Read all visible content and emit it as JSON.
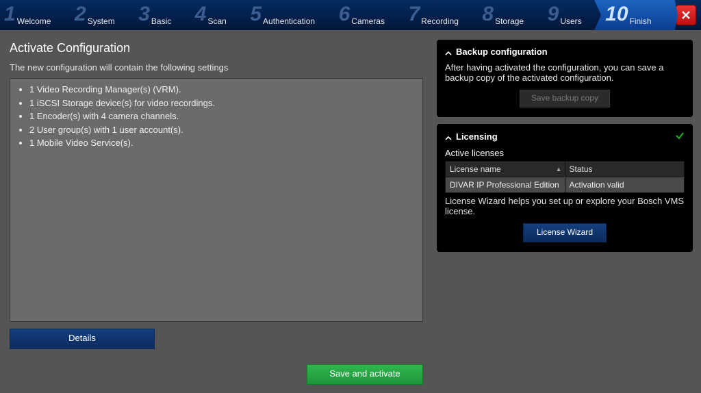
{
  "wizard": {
    "steps": [
      {
        "num": "1",
        "label": "Welcome"
      },
      {
        "num": "2",
        "label": "System"
      },
      {
        "num": "3",
        "label": "Basic"
      },
      {
        "num": "4",
        "label": "Scan"
      },
      {
        "num": "5",
        "label": "Authentication"
      },
      {
        "num": "6",
        "label": "Cameras"
      },
      {
        "num": "7",
        "label": "Recording"
      },
      {
        "num": "8",
        "label": "Storage"
      },
      {
        "num": "9",
        "label": "Users"
      },
      {
        "num": "10",
        "label": "Finish"
      }
    ],
    "active_index": 9
  },
  "page": {
    "title": "Activate Configuration",
    "subtitle": "The new configuration will contain the following settings",
    "config_items": [
      "1 Video Recording Manager(s) (VRM).",
      "1 iSCSI Storage device(s) for video recordings.",
      "1 Encoder(s) with 4 camera channels.",
      "2 User group(s) with 1 user account(s).",
      "1 Mobile Video Service(s)."
    ],
    "details_btn": "Details",
    "save_activate_btn": "Save and activate"
  },
  "backup": {
    "title": "Backup configuration",
    "text": "After having activated the configuration, you can save a backup copy of the activated configuration.",
    "button": "Save backup copy"
  },
  "licensing": {
    "title": "Licensing",
    "active_label": "Active licenses",
    "col_name": "License name",
    "col_status": "Status",
    "rows": [
      {
        "name": "DIVAR IP Professional Edition",
        "status": "Activation valid"
      }
    ],
    "help_text": "License Wizard helps you set up or explore your Bosch VMS license.",
    "wizard_btn": "License Wizard"
  }
}
